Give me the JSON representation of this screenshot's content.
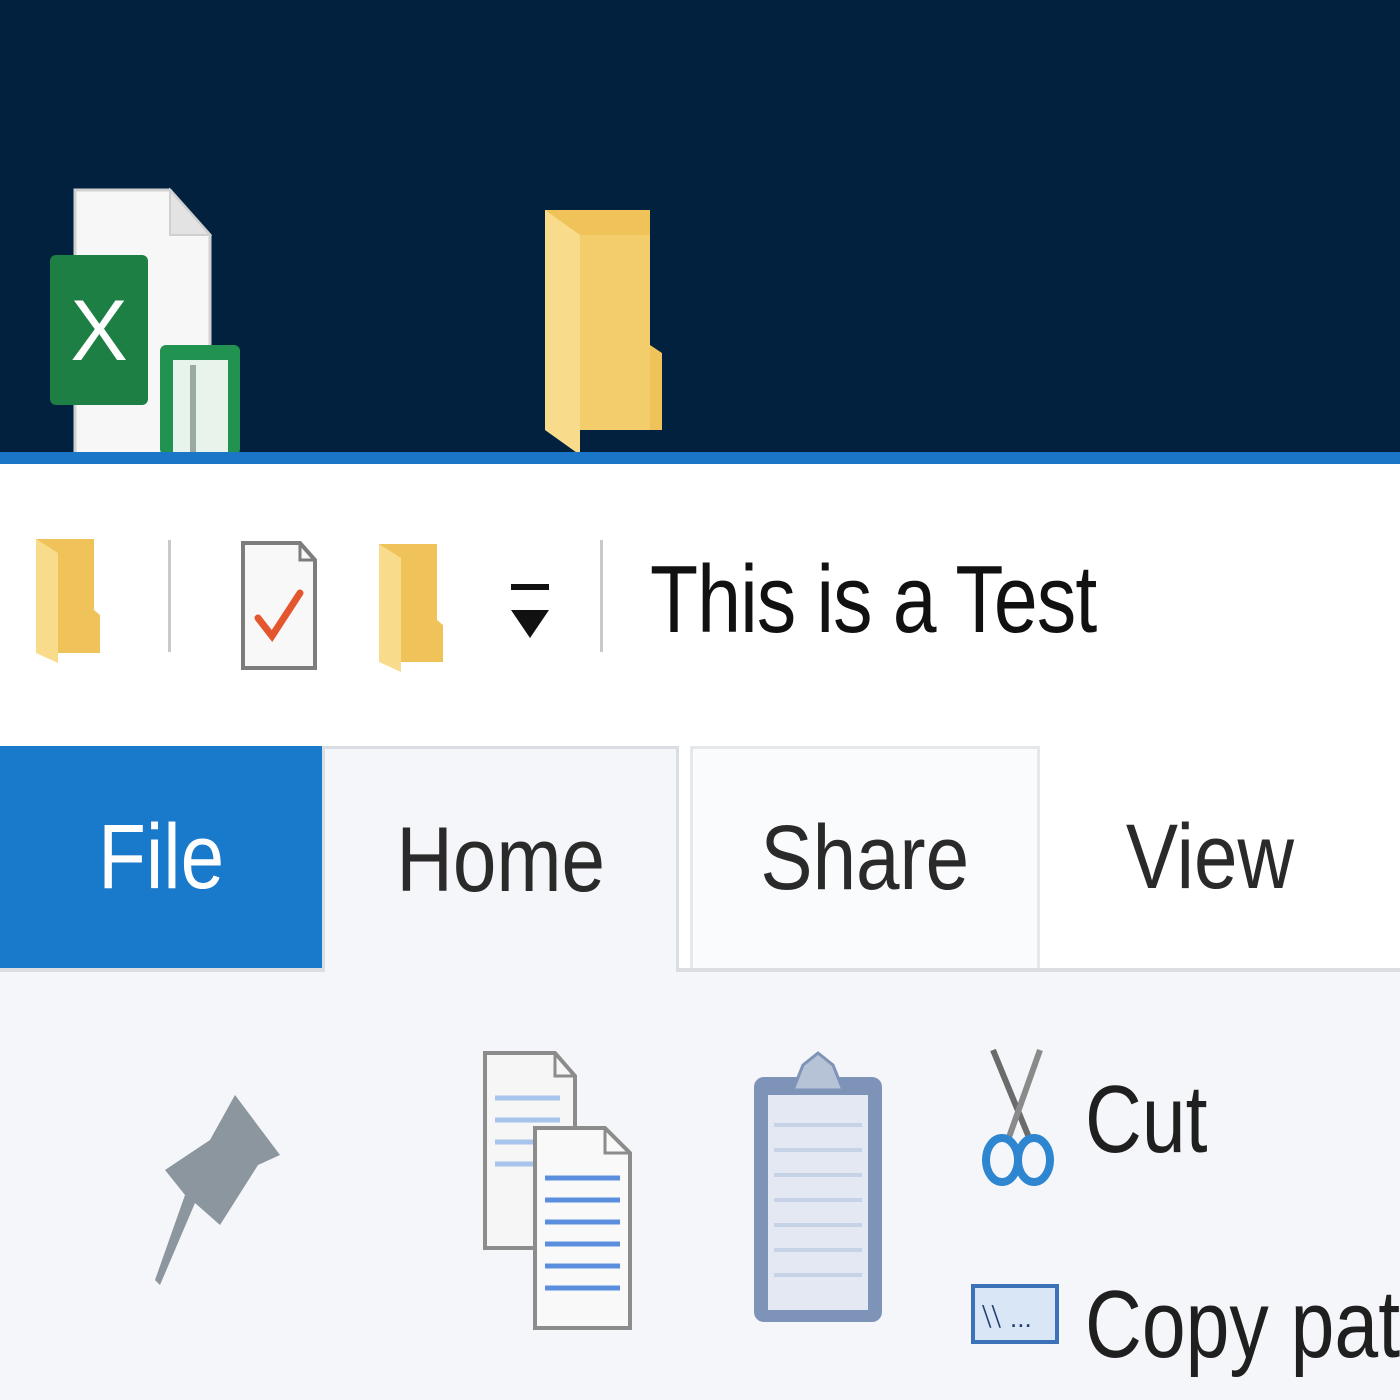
{
  "window": {
    "title": "This is a Test"
  },
  "quick_access_toolbar": {
    "items": [
      {
        "icon": "folder-icon"
      },
      {
        "icon": "properties-checkmark-icon"
      },
      {
        "icon": "new-folder-icon"
      },
      {
        "icon": "customize-dropdown-icon"
      }
    ]
  },
  "tabs": [
    {
      "label": "File",
      "active": false
    },
    {
      "label": "Home",
      "active": true
    },
    {
      "label": "Share",
      "active": false
    },
    {
      "label": "View",
      "active": false
    }
  ],
  "ribbon": {
    "clipboard": {
      "pin_icon": "pin-to-quick-access-icon",
      "copy_icon": "copy-icon",
      "paste_icon": "paste-icon",
      "cut_label": "Cut",
      "copy_path_label": "Copy path"
    }
  },
  "desktop": {
    "icons": [
      {
        "icon": "excel-file-icon"
      },
      {
        "icon": "folder-icon"
      }
    ]
  },
  "colors": {
    "desktop_background": "#02213f",
    "accent": "#1979ca",
    "ribbon_background": "#f4f6f9",
    "folder_yellow": "#f5d478"
  }
}
